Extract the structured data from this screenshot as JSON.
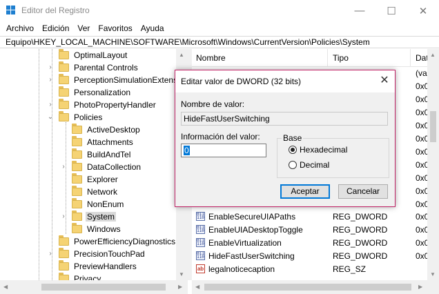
{
  "window": {
    "title": "Editor del Registro",
    "minimize": "—",
    "maximize": "☐",
    "close": "✕"
  },
  "menu": [
    "Archivo",
    "Edición",
    "Ver",
    "Favoritos",
    "Ayuda"
  ],
  "address": "Equipo\\HKEY_LOCAL_MACHINE\\SOFTWARE\\Microsoft\\Windows\\CurrentVersion\\Policies\\System",
  "tree": {
    "items": [
      {
        "label": "OptimalLayout",
        "level": 0,
        "expander": ""
      },
      {
        "label": "Parental Controls",
        "level": 0,
        "expander": "›"
      },
      {
        "label": "PerceptionSimulationExtensi",
        "level": 0,
        "expander": "›"
      },
      {
        "label": "Personalization",
        "level": 0,
        "expander": ""
      },
      {
        "label": "PhotoPropertyHandler",
        "level": 0,
        "expander": "›"
      },
      {
        "label": "Policies",
        "level": 0,
        "expander": "⌄"
      },
      {
        "label": "ActiveDesktop",
        "level": 1,
        "expander": ""
      },
      {
        "label": "Attachments",
        "level": 1,
        "expander": ""
      },
      {
        "label": "BuildAndTel",
        "level": 1,
        "expander": ""
      },
      {
        "label": "DataCollection",
        "level": 1,
        "expander": "›"
      },
      {
        "label": "Explorer",
        "level": 1,
        "expander": ""
      },
      {
        "label": "Network",
        "level": 1,
        "expander": ""
      },
      {
        "label": "NonEnum",
        "level": 1,
        "expander": ""
      },
      {
        "label": "System",
        "level": 1,
        "expander": "›",
        "selected": true
      },
      {
        "label": "Windows",
        "level": 1,
        "expander": ""
      },
      {
        "label": "PowerEfficiencyDiagnostics",
        "level": 0,
        "expander": ""
      },
      {
        "label": "PrecisionTouchPad",
        "level": 0,
        "expander": "›"
      },
      {
        "label": "PreviewHandlers",
        "level": 0,
        "expander": ""
      },
      {
        "label": "Privacy",
        "level": 0,
        "expander": ""
      }
    ]
  },
  "list": {
    "headers": {
      "name": "Nombre",
      "type": "Tipo",
      "data": "Dat"
    },
    "rows": [
      {
        "name": "",
        "type": "",
        "data": "(va"
      },
      {
        "name": "",
        "type": "",
        "data": "0x0"
      },
      {
        "name": "",
        "type": "",
        "data": "0x0"
      },
      {
        "name": "",
        "type": "",
        "data": "0x0"
      },
      {
        "name": "",
        "type": "",
        "data": "0x0"
      },
      {
        "name": "",
        "type": "",
        "data": "0x0"
      },
      {
        "name": "",
        "type": "",
        "data": "0x0"
      },
      {
        "name": "",
        "type": "",
        "data": "0x0"
      },
      {
        "name": "",
        "type": "",
        "data": "0x0"
      },
      {
        "name": "",
        "type": "",
        "data": "0x0"
      },
      {
        "name": "",
        "type": "",
        "data": "0x0"
      },
      {
        "name": "EnableSecureUIAPaths",
        "type": "REG_DWORD",
        "data": "0x0",
        "icon": "dword"
      },
      {
        "name": "EnableUIADesktopToggle",
        "type": "REG_DWORD",
        "data": "0x0",
        "icon": "dword"
      },
      {
        "name": "EnableVirtualization",
        "type": "REG_DWORD",
        "data": "0x0",
        "icon": "dword"
      },
      {
        "name": "HideFastUserSwitching",
        "type": "REG_DWORD",
        "data": "0x0",
        "icon": "dword"
      },
      {
        "name": "legalnoticecaption",
        "type": "REG_SZ",
        "data": "",
        "icon": "sz"
      }
    ]
  },
  "dialog": {
    "title": "Editar valor de DWORD (32 bits)",
    "close": "✕",
    "name_label": "Nombre de valor:",
    "name_value": "HideFastUserSwitching",
    "value_label": "Información del valor:",
    "value": "0",
    "base_label": "Base",
    "radio_hex": "Hexadecimal",
    "radio_dec": "Decimal",
    "ok": "Aceptar",
    "cancel": "Cancelar"
  }
}
